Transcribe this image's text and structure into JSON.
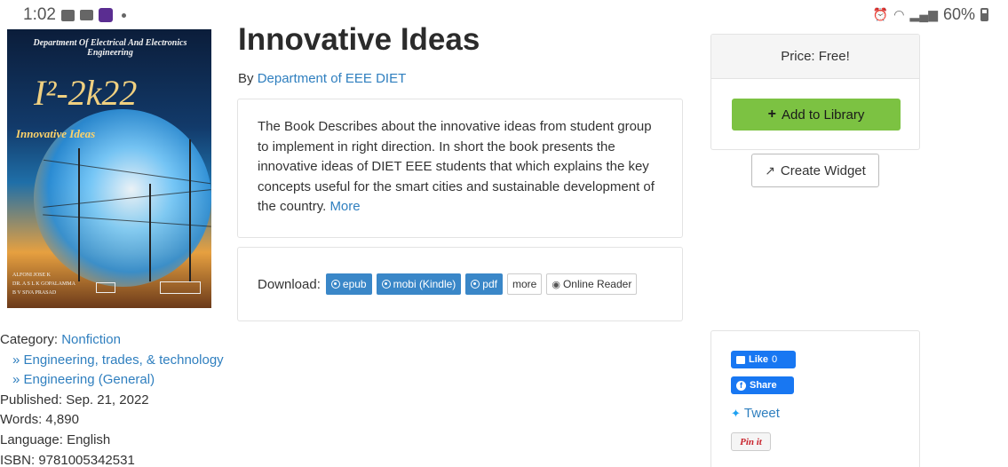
{
  "status_bar": {
    "time": "1:02",
    "app_badge": "yono SBI",
    "battery": "60%",
    "network": "Vo)) LTE1"
  },
  "cover": {
    "department": "Department Of Electrical And Electronics Engineering",
    "code": "I²-2k22",
    "title": "Innovative Ideas",
    "authors": [
      "ALFONI JOSE K",
      "DR. A S L K GOPALAMMA",
      "B V SIVA PRASAD"
    ]
  },
  "book": {
    "title": "Innovative Ideas",
    "by_prefix": "By",
    "author": "Department of EEE DIET",
    "description": "The Book Describes about the innovative ideas from student group to implement in right direction. In short the book presents the innovative ideas of DIET EEE students that which explains the key concepts useful for the smart cities and sustainable development of the country.",
    "more_link": "More"
  },
  "download": {
    "label": "Download:",
    "formats": [
      "epub",
      "mobi (Kindle)",
      "pdf"
    ],
    "more": "more",
    "online_reader": "Online Reader"
  },
  "pricing": {
    "price_label": "Price: Free!",
    "add_button": "Add to Library",
    "widget_button": "Create Widget"
  },
  "details": {
    "category_label": "Category:",
    "category": "Nonfiction",
    "subcategories": [
      "» Engineering, trades, & technology",
      "» Engineering (General)"
    ],
    "published": "Published: Sep. 21, 2022",
    "words": "Words: 4,890",
    "language": "Language: English",
    "isbn": "ISBN: 9781005342531"
  },
  "social": {
    "like": "Like",
    "like_count": "0",
    "share": "Share",
    "tweet": "Tweet",
    "pin": "Pin it"
  },
  "colors": {
    "link": "#2f7fbf",
    "button_blue": "#3a87c8",
    "add_green": "#7cc242",
    "facebook": "#1877f2"
  }
}
